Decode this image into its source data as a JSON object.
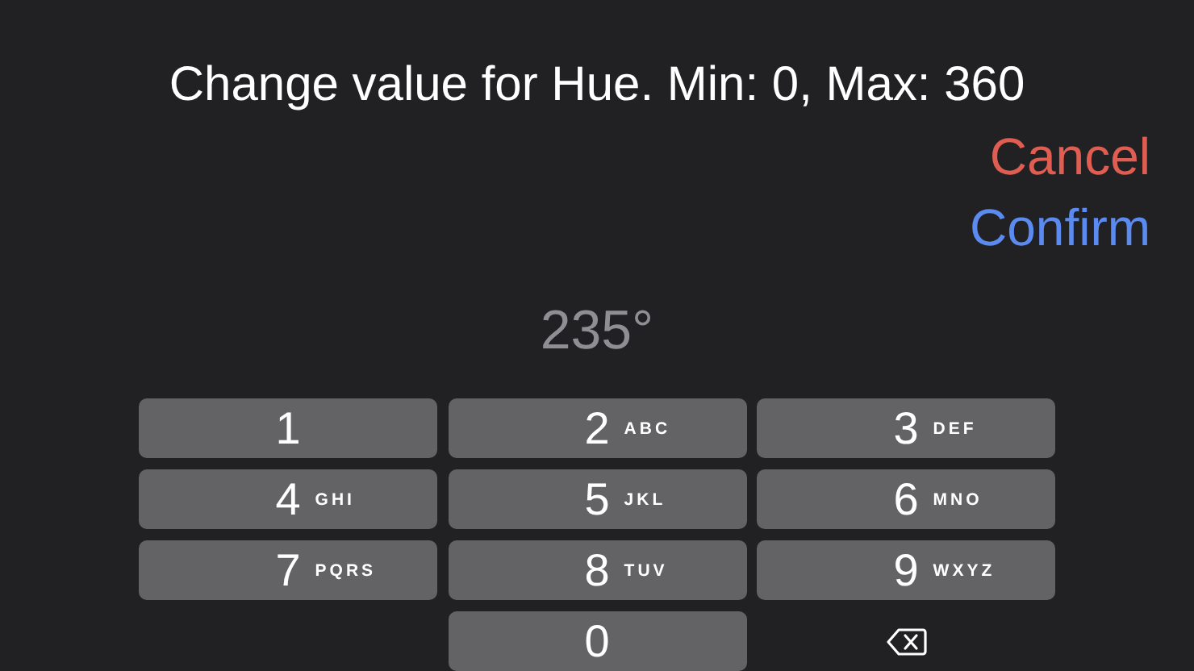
{
  "prompt": {
    "title": "Change value for Hue. Min: 0, Max: 360"
  },
  "actions": [
    {
      "label": "Cancel",
      "kind": "cancel"
    },
    {
      "label": "Confirm",
      "kind": "confirm"
    }
  ],
  "value": "235°",
  "keypad": [
    {
      "kind": "digit",
      "digit": "1"
    },
    {
      "kind": "digit",
      "digit": "2",
      "letters": "ABC"
    },
    {
      "kind": "digit",
      "digit": "3",
      "letters": "DEF"
    },
    {
      "kind": "digit",
      "digit": "4",
      "letters": "GHI"
    },
    {
      "kind": "digit",
      "digit": "5",
      "letters": "JKL"
    },
    {
      "kind": "digit",
      "digit": "6",
      "letters": "MNO"
    },
    {
      "kind": "digit",
      "digit": "7",
      "letters": "PQRS"
    },
    {
      "kind": "digit",
      "digit": "8",
      "letters": "TUV"
    },
    {
      "kind": "digit",
      "digit": "9",
      "letters": "WXYZ"
    },
    {
      "kind": "blank"
    },
    {
      "kind": "digit",
      "digit": "0"
    },
    {
      "kind": "delete"
    }
  ]
}
